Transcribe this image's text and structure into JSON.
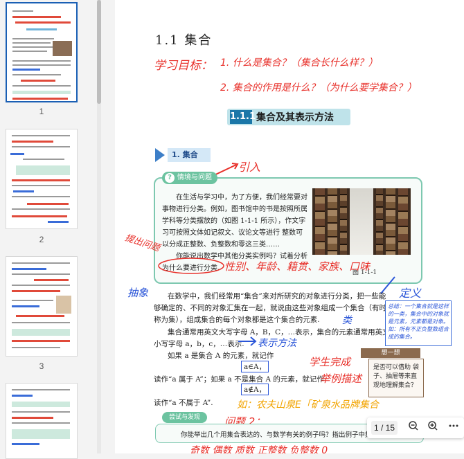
{
  "sidebar": {
    "pages": [
      {
        "number": "1"
      },
      {
        "number": "2"
      },
      {
        "number": "3"
      },
      {
        "number": ""
      }
    ]
  },
  "document": {
    "section_title": "1.1  集合",
    "hand_objective_label": "学习目标：",
    "hand_objective_1": "1. 什么是集合？（集合长什么样？）",
    "hand_objective_2": "2. 集合的作用是什么？（为什么要学集合？）",
    "banner_num": "1.1.1",
    "banner_text": "集合及其表示方法",
    "subsection_tag": "1. 集合",
    "hand_intro": "引入",
    "panel_tag": "情境与问题",
    "panel_lines": [
      "在生活与学习中，为了方便，我们经常要对",
      "事物进行分类。例如，图书馆中的书是按照所属",
      "学科等分类摆放的（如图 1-1-1 所示），作文字",
      "习可按照文体如记叙文、议论文等进行    整数可",
      "以分成正整数、负整数和零这三类……",
      "你能说出数学中其他分类实例吗？试着分析",
      "为什么要进行分类."
    ],
    "figure_caption": "图 1-1-1",
    "hand_question": "提出问题",
    "hand_answers": "性别、年龄、籍贯、家族、口味",
    "hand_abstract": "抽象",
    "hand_definition": "定义",
    "body_lines": [
      "在数学中，我们经常用“集合”来对所研究的对象进行分类，把一些能",
      "够确定的、不同的对象汇集在一起，就说由这些对象组成一个集合（有时简",
      "称为集），组成集合的每个对象都是这个集合的元素.",
      "集合通常用英文大写字母 A，B，C，…表示，集合的元素通常用英文",
      "小写字母 a，b，c，…表示.",
      "如果 a 是集合 A 的元素，就记作",
      "读作“a 属于 A”；如果 a 不是集合 A 的元素，就记作",
      "读作“a 不属于 A”."
    ],
    "formula_in": "a∈A，",
    "formula_notin": "a∉A，",
    "hand_class": "类",
    "hand_repr": "表示方法",
    "note_text": "总结：一个集合就是这样的一类，集合中的对象就是元素，元素都是对象。如：所有不正负整数组合成的集合。",
    "think_label": "想一想",
    "think_text": "是否可以借助 袋子、抽屉等来直 观地理解集合？",
    "hand_student": "学生完成",
    "hand_example": "举例描述",
    "hand_eg": "如：农夫山泉E「矿泉水品牌集合",
    "try_label": "尝试与发现",
    "hand_q2": "问题 2：",
    "try_text": "你能举出几个用集合表达的、与数学有关的例子吗？指出例子中集",
    "hand_bottom": "奇数  偶数  质数  正整数  负整数  0"
  },
  "toolbar": {
    "page_indicator": "1 / 15",
    "zoom_out_icon": "zoom-out-icon",
    "zoom_in_icon": "zoom-in-icon",
    "more_icon": "more-icon"
  },
  "colors": {
    "annotation_red": "#e8302a",
    "annotation_blue": "#2a55d8",
    "panel_green": "#7dc8b0",
    "banner_blue": "#1b77a8"
  }
}
